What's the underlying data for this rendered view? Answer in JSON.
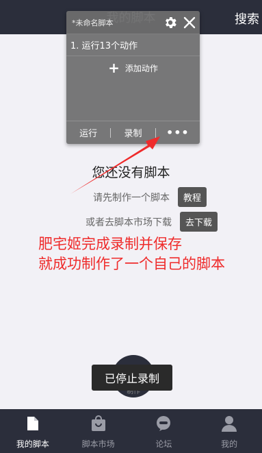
{
  "topbar": {
    "title": "我的脚本",
    "search_label": "搜索"
  },
  "float_panel": {
    "script_name": "*未命名脚本",
    "gear_icon": "gear-icon",
    "close_icon": "close-icon",
    "action_item": "1. 运行13个动作",
    "add_action_label": "添加动作",
    "footer": {
      "run": "运行",
      "record": "录制",
      "more": "•••"
    }
  },
  "empty": {
    "title": "您还没有脚本",
    "line1": "请先制作一个脚本",
    "tutorial_button": "教程",
    "line2": "或者去脚本市场下载",
    "download_button": "去下载"
  },
  "annotation": {
    "line1": "肥宅姬完成录制并保存",
    "line2": "就成功制作了一个自己的脚本"
  },
  "fab": {
    "label": "制作"
  },
  "toast": {
    "text": "已停止录制"
  },
  "tabbar": {
    "items": [
      {
        "label": "我的脚本",
        "icon": "document-icon",
        "active": true
      },
      {
        "label": "脚本市场",
        "icon": "shopping-bag-icon",
        "active": false
      },
      {
        "label": "论坛",
        "icon": "chat-bubble-icon",
        "active": false
      },
      {
        "label": "我的",
        "icon": "person-icon",
        "active": false
      }
    ]
  },
  "colors": {
    "topbar": "#2b2e3b",
    "annotation": "#ef2b2b",
    "background": "#f2f1f6",
    "chip": "#555555"
  }
}
